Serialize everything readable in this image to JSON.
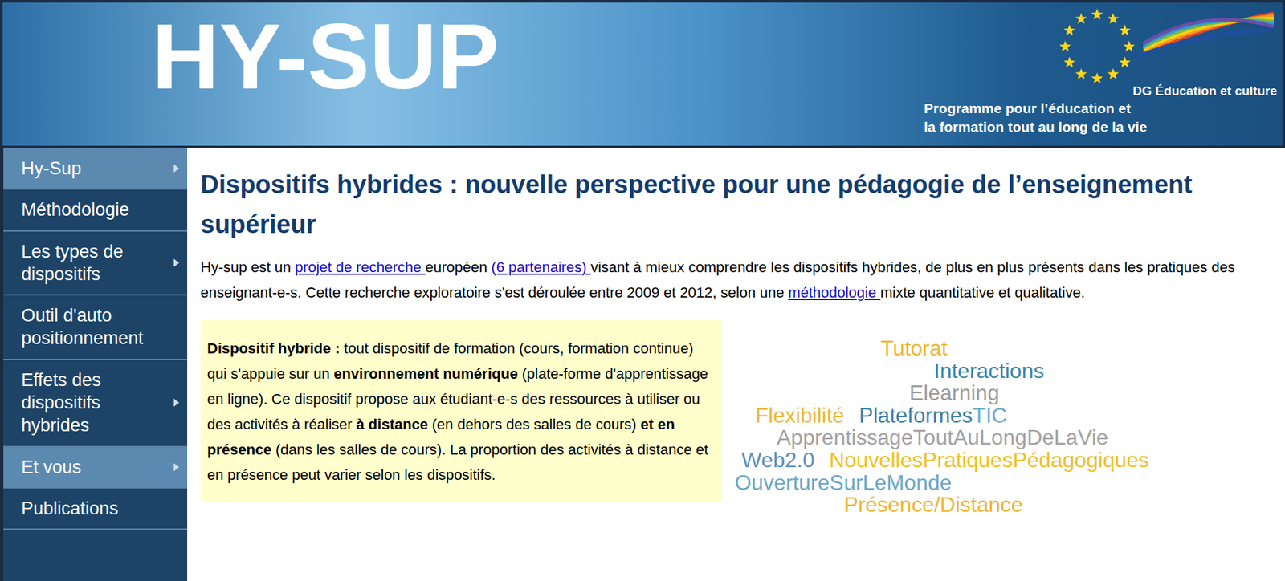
{
  "header": {
    "logo": "HY-SUP",
    "dg": "DG Éducation et culture",
    "programme_lines": [
      "Programme pour l’éducation et",
      "la formation tout au long de la vie"
    ]
  },
  "sidebar": {
    "items": [
      {
        "label": "Hy-Sup",
        "selected": true,
        "has_submenu": true
      },
      {
        "label": "Méthodologie",
        "selected": false,
        "has_submenu": false
      },
      {
        "label": "Les types de dispositifs",
        "selected": false,
        "has_submenu": true
      },
      {
        "label": "Outil d'auto positionnement",
        "selected": false,
        "has_submenu": false
      },
      {
        "label": "Effets des dispositifs hybrides",
        "selected": false,
        "has_submenu": true
      },
      {
        "label": "Et vous",
        "selected": true,
        "has_submenu": true
      },
      {
        "label": "Publications",
        "selected": false,
        "has_submenu": false
      }
    ]
  },
  "main": {
    "title": "Dispositifs hybrides : nouvelle perspective pour une pédagogie de l’enseignement supérieur",
    "intro": [
      {
        "text": "Hy-sup est un ",
        "link": false
      },
      {
        "text": "projet de recherche ",
        "link": true
      },
      {
        "text": "européen ",
        "link": false
      },
      {
        "text": "(6 partenaires) ",
        "link": true
      },
      {
        "text": "visant à mieux comprendre les dispositifs hybrides, de plus en plus présents dans les pratiques des enseignant-e-s. Cette recherche exploratoire s'est déroulée entre 2009 et 2012, selon une ",
        "link": false
      },
      {
        "text": "méthodologie ",
        "link": true
      },
      {
        "text": "mixte quantitative et qualitative.",
        "link": false
      }
    ],
    "definition": [
      {
        "text": "Dispositif hybride :",
        "bold": true
      },
      {
        "text": " tout dispositif de formation (cours, formation continue) qui s'appuie sur un ",
        "bold": false
      },
      {
        "text": "environnement numérique",
        "bold": true
      },
      {
        "text": " (plate-forme d'apprentissage en ligne). Ce dispositif propose aux étudiant-e-s des ressources à utiliser ou des activités à réaliser ",
        "bold": false
      },
      {
        "text": "à distance",
        "bold": true
      },
      {
        "text": " (en dehors des salles de cours) ",
        "bold": false
      },
      {
        "text": "et en présence",
        "bold": true
      },
      {
        "text": " (dans les salles de cours). La proportion des activités à distance et en présence peut varier selon les dispositifs.",
        "bold": false
      }
    ],
    "word_cloud": [
      [
        [
          {
            "text": "Tutorat",
            "color": "#f0b530"
          }
        ]
      ],
      [
        [
          {
            "text": "Interactions",
            "color": "#3a86a8"
          }
        ]
      ],
      [
        [
          {
            "text": "Elearning",
            "color": "#9b9b9b"
          }
        ]
      ],
      [
        [
          {
            "text": "Flexibilité",
            "color": "#f0b530"
          }
        ],
        [
          {
            "text": "Plateformes",
            "color": "#3a7fa8"
          },
          {
            "text": "TIC",
            "color": "#6aaed0"
          }
        ]
      ],
      [
        [
          {
            "text": "ApprentissageToutAuLongDeLaVie",
            "color": "#a2a2a2"
          }
        ]
      ],
      [
        [
          {
            "text": "Web2.0",
            "color": "#5a8fc0"
          }
        ],
        [
          {
            "text": "NouvellesPratiquesPédagogiques",
            "color": "#f2c022"
          }
        ]
      ],
      [
        [
          {
            "text": "OuvertureSurLeMonde",
            "color": "#6aa7c8"
          }
        ]
      ],
      [
        [
          {
            "text": "Présence/Distance",
            "color": "#f0b530"
          }
        ]
      ]
    ]
  }
}
